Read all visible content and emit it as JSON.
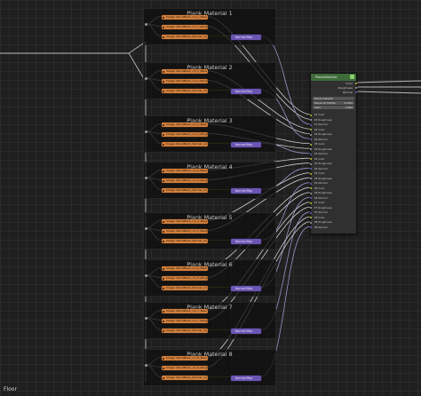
{
  "editor": {
    "name_label": "Floor"
  },
  "frames": [
    {
      "title": "Plank Material 1",
      "textures": [
        "Image: WoodPlank_col_1_Base Color",
        "Image: WoodPlank_col_1_Roughness",
        "Image: WoodPlank_Normal_col_1_Normal"
      ],
      "normal_map": "Normal Map"
    },
    {
      "title": "Plank Material 2",
      "textures": [
        "Image: WoodPlank_col_2_Base Color",
        "Image: WoodPlank_col_2_Roughness",
        "Image: WoodPlank_Normal_col_2_Normal"
      ],
      "normal_map": "Normal Map"
    },
    {
      "title": "Plank Material 3",
      "textures": [
        "Image: WoodPlank_col_3_Base Color",
        "Image: WoodPlank_col_3_Roughness",
        "Image: WoodPlank_Normal_col_3_Normal"
      ],
      "normal_map": "Normal Map"
    },
    {
      "title": "Plank Material 4",
      "textures": [
        "Image: WoodPlank_col_4_Base Color",
        "Image: WoodPlank_col_4_Roughness",
        "Image: WoodPlank_Normal_col_4_Normal"
      ],
      "normal_map": "Normal Map"
    },
    {
      "title": "Plank Material 5",
      "textures": [
        "Image: WoodPlank_col_5_Base Color",
        "Image: WoodPlank_col_5_Roughness",
        "Image: WoodPlank_Normal_col_5_Normal"
      ],
      "normal_map": "Normal Map"
    },
    {
      "title": "Plank Material 6",
      "textures": [
        "Image: WoodPlank_col_6_Base Color",
        "Image: WoodPlank_col_6_Roughness",
        "Image: WoodPlank_Normal_col_6_Normal"
      ],
      "normal_map": "Normal Map"
    },
    {
      "title": "Plank Material 7",
      "textures": [
        "Image: WoodPlank_col_7_Base Color",
        "Image: WoodPlank_col_7_Roughness",
        "Image: WoodPlank_Normal_col_7_Normal"
      ],
      "normal_map": "Normal Map"
    },
    {
      "title": "Plank Material 8",
      "textures": [
        "Image: WoodPlank_col_8_Base Color",
        "Image: WoodPlank_col_8_Roughness",
        "Image: WoodPlank_Normal_col_8_Normal"
      ],
      "normal_map": "Normal Map"
    }
  ],
  "group_node": {
    "title": "PlanksSelector",
    "outputs": [
      "Color",
      "Roughness",
      "Normal"
    ],
    "fields": [
      {
        "label": "Planks Selector",
        "value": ""
      },
      {
        "label": "Planks Of Shuffle",
        "value": "23.000"
      },
      {
        "label": "Seed",
        "value": "3.000"
      }
    ],
    "inputs": [
      "P1 Color",
      "P1 Roughness",
      "P1 Normal",
      "P2 Color",
      "P2 Roughness",
      "P2 Normal",
      "P3 Color",
      "P3 Roughness",
      "P3 Normal",
      "P4 Color",
      "P4 Roughness",
      "P4 Normal",
      "P5 Color",
      "P5 Roughness",
      "P5 Normal",
      "P6 Color",
      "P6 Roughness",
      "P6 Normal",
      "P7 Color",
      "P7 Roughness",
      "P7 Normal",
      "P8 Color",
      "P8 Roughness",
      "P8 Normal"
    ]
  },
  "colors": {
    "image_texture_node": "#d2803e",
    "normal_map_node": "#6a56b2",
    "group_header": "#3f6b3a",
    "color_socket": "#c7c729",
    "float_socket": "#a1a1a1",
    "vector_socket": "#6363c7"
  }
}
